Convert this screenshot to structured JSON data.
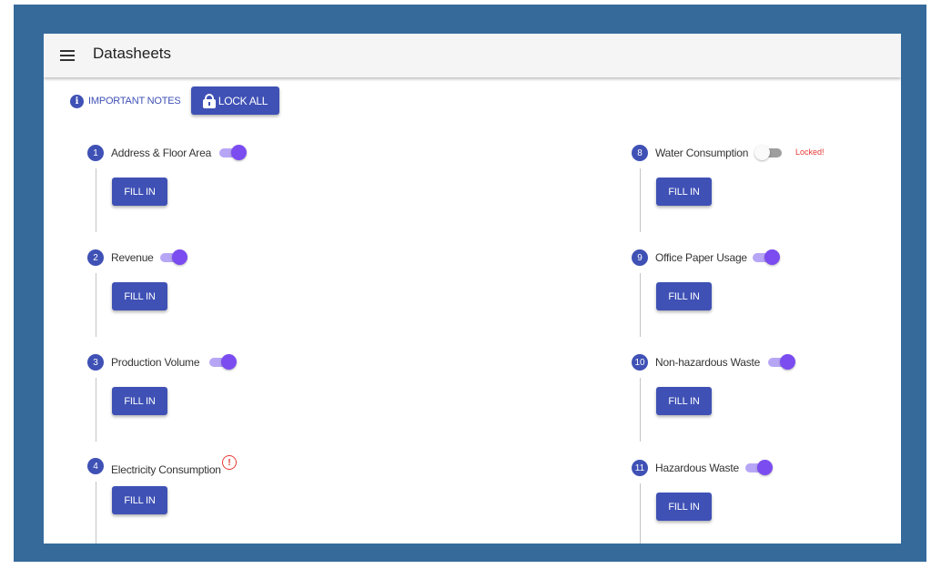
{
  "header": {
    "title": "Datasheets"
  },
  "toolbar": {
    "notes_label": "IMPORTANT NOTES",
    "info_glyph": "i",
    "lock_all_label": "LOCK ALL"
  },
  "fill_label": "FILL IN",
  "steps": [
    {
      "num": "1",
      "label": "Address & Floor Area",
      "toggle": "on"
    },
    {
      "num": "2",
      "label": "Revenue",
      "toggle": "on"
    },
    {
      "num": "3",
      "label": "Production Volume",
      "toggle": "on"
    },
    {
      "num": "4",
      "label": "Electricity Consumption",
      "warning": "!"
    },
    {
      "num": "8",
      "label": "Water Consumption",
      "toggle": "off",
      "status": "Locked!"
    },
    {
      "num": "9",
      "label": "Office Paper Usage",
      "toggle": "on"
    },
    {
      "num": "10",
      "label": "Non-hazardous Waste",
      "toggle": "on"
    },
    {
      "num": "11",
      "label": "Hazardous Waste",
      "toggle": "on"
    }
  ],
  "colors": {
    "frame": "#356a9b",
    "primary": "#3f51b5",
    "toggle_on": "#7b4cf0",
    "warning": "#e53935"
  }
}
